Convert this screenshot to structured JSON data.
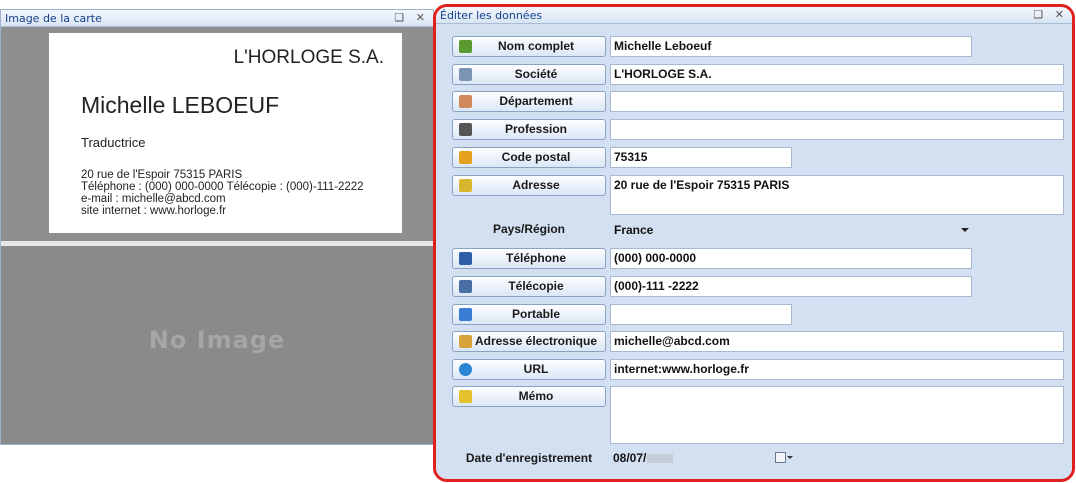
{
  "card_pane": {
    "title": "Image de la carte",
    "controls": "❑ ✕",
    "card": {
      "company": "L'HORLOGE S.A.",
      "name": "Michelle LEBOEUF",
      "job_title": "Traductrice",
      "address_line": "20 rue de l'Espoir 75315 PARIS",
      "phone_line": "Téléphone : (000) 000-0000   Télécopie : (000)-111-2222",
      "email_line": "e-mail : michelle@abcd.com",
      "site_line": "site internet : www.horloge.fr"
    },
    "back_side_text": "No Image"
  },
  "edit_pane": {
    "title": "Éditer les données",
    "controls": "❑ ✕",
    "fields": {
      "full_name": {
        "label": "Nom complet",
        "value": "Michelle Leboeuf",
        "icon": "person-icon",
        "color": "#5a9a2e"
      },
      "company": {
        "label": "Société",
        "value": "L'HORLOGE S.A.",
        "icon": "building-icon",
        "color": "#7d93b5"
      },
      "department": {
        "label": "Département",
        "value": "",
        "icon": "door-icon",
        "color": "#d08a5a"
      },
      "profession": {
        "label": "Profession",
        "value": "",
        "icon": "worker-icon",
        "color": "#555555"
      },
      "postal_code": {
        "label": "Code postal",
        "value": "75315",
        "icon": "postal-icon",
        "color": "#e6a21e"
      },
      "address": {
        "label": "Adresse",
        "value": "20 rue de l'Espoir 75315 PARIS",
        "icon": "house-icon",
        "color": "#d6b62c"
      },
      "country": {
        "label": "Pays/Région",
        "value": "France"
      },
      "phone": {
        "label": "Téléphone",
        "value": "(000) 000-0000",
        "icon": "phone-icon",
        "color": "#2d5fa8"
      },
      "fax": {
        "label": "Télécopie",
        "value": "(000)-111 -2222",
        "icon": "fax-icon",
        "color": "#4a6fa5"
      },
      "mobile": {
        "label": "Portable",
        "value": "",
        "icon": "mobile-icon",
        "color": "#3a7bd5"
      },
      "email": {
        "label": "Adresse électronique",
        "value": "michelle@abcd.com",
        "icon": "mail-icon",
        "color": "#d9a23a"
      },
      "url": {
        "label": "URL",
        "value": "internet:www.horloge.fr",
        "icon": "globe-icon",
        "color": "#2a86d1"
      },
      "memo": {
        "label": "Mémo",
        "value": "",
        "icon": "note-icon",
        "color": "#e6c12e"
      },
      "date": {
        "label": "Date d'enregistrement",
        "value": "08/07/"
      }
    }
  }
}
